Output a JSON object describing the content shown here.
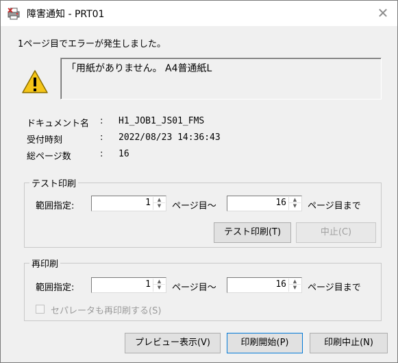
{
  "window": {
    "title": "障害通知 - PRT01",
    "close_glyph": "✕"
  },
  "message": "1ページ目でエラーが発生しました。",
  "error_text": "「用紙がありません。 A4普通紙L",
  "info": {
    "document_label": "ドキュメント名",
    "document_value": "H1_JOB1_JS01_FMS",
    "received_label": "受付時刻",
    "received_value": "2022/08/23 14:36:43",
    "pages_label": "総ページ数",
    "pages_value": "16",
    "colon": ":"
  },
  "test_print": {
    "group_title": "テスト印刷",
    "range_label": "範囲指定:",
    "from_value": "1",
    "from_suffix": "ページ目〜",
    "to_value": "16",
    "to_suffix": "ページ目まで",
    "test_button": "テスト印刷(T)",
    "stop_button": "中止(C)"
  },
  "reprint": {
    "group_title": "再印刷",
    "range_label": "範囲指定:",
    "from_value": "1",
    "from_suffix": "ページ目〜",
    "to_value": "16",
    "to_suffix": "ページ目まで",
    "separator_checkbox": "セパレータも再印刷する(S)"
  },
  "footer": {
    "preview_button": "プレビュー表示(V)",
    "start_button": "印刷開始(P)",
    "cancel_button": "印刷中止(N)"
  },
  "icons": {
    "app": "printer-error-icon",
    "warning": "warning-icon",
    "close": "close-icon"
  },
  "colors": {
    "warning_fill": "#f5c518",
    "warning_mark": "#000000",
    "dialog_bg": "#f0f0f0"
  }
}
